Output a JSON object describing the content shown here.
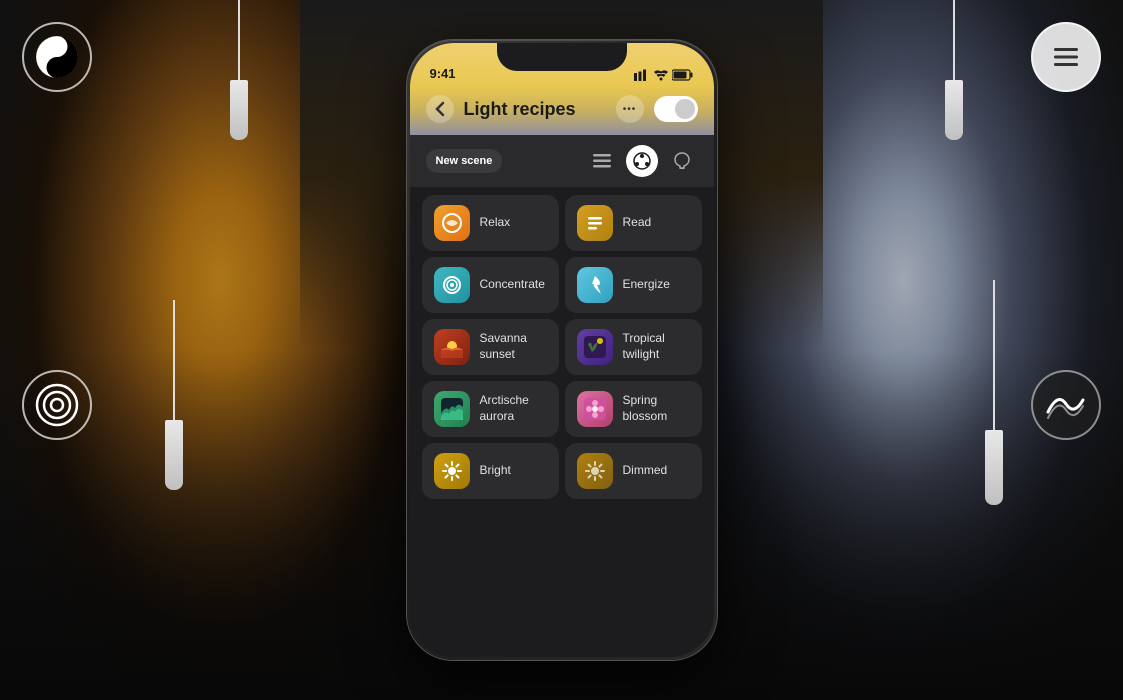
{
  "background": {
    "description": "Dark background with warm left glow and cool right glow from pendant lamps"
  },
  "corner_icons": {
    "top_left": "yin-yang",
    "top_right": "menu-lines",
    "mid_left": "concentric-circles",
    "mid_right": "mountain-wave"
  },
  "phone": {
    "status_bar": {
      "time": "9:41",
      "signal": "●●●",
      "wifi": "wifi",
      "battery": "battery"
    },
    "header": {
      "back_label": "‹",
      "title": "Light recipes",
      "more_label": "•••",
      "toggle_on": true
    },
    "toolbar": {
      "new_scene_label": "New scene",
      "new_scene_prefix": "New",
      "new_scene_suffix": "scene",
      "list_icon": "list",
      "palette_icon": "palette",
      "bulb_icon": "bulb"
    },
    "recipes": [
      {
        "id": "relax",
        "label": "Relax",
        "icon": "relax",
        "color": "#f0a030"
      },
      {
        "id": "read",
        "label": "Read",
        "icon": "read",
        "color": "#d4a020"
      },
      {
        "id": "concentrate",
        "label": "Concentrate",
        "icon": "concentrate",
        "color": "#40b8c0"
      },
      {
        "id": "energize",
        "label": "Energize",
        "icon": "energize",
        "color": "#60c8e0"
      },
      {
        "id": "savanna-sunset",
        "label": "Savanna sunset",
        "icon": "savanna",
        "color": "#c04020"
      },
      {
        "id": "tropical-twilight",
        "label": "Tropical twilight",
        "icon": "tropical",
        "color": "#6040a0"
      },
      {
        "id": "arctische-aurora",
        "label": "Arctische aurora",
        "icon": "arctic",
        "color": "#40a870"
      },
      {
        "id": "spring-blossom",
        "label": "Spring blossom",
        "icon": "spring",
        "color": "#e070a0"
      },
      {
        "id": "bright",
        "label": "Bright",
        "icon": "bright",
        "color": "#d0a010"
      },
      {
        "id": "dimmed",
        "label": "Dimmed",
        "icon": "dimmed",
        "color": "#b08010"
      }
    ]
  }
}
